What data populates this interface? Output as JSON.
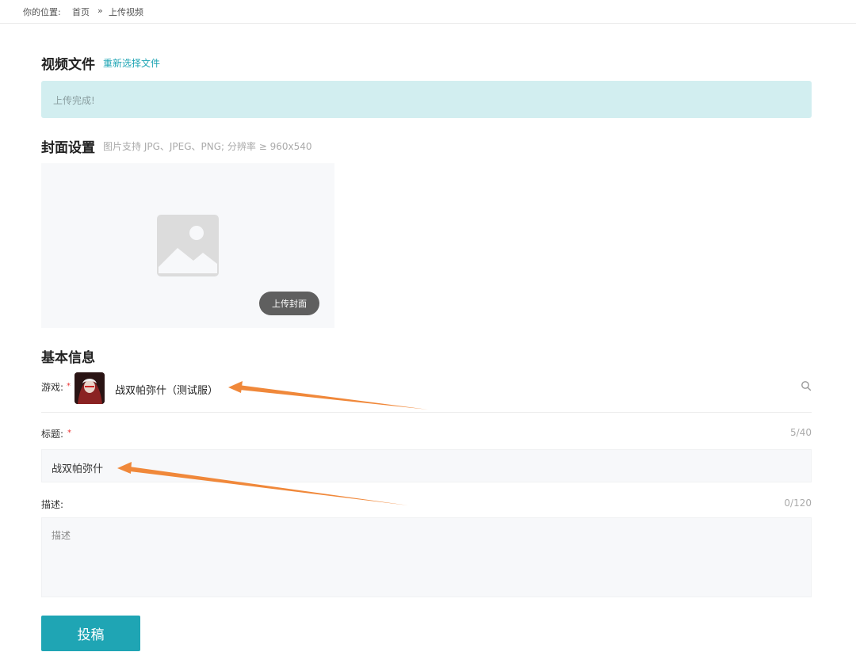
{
  "breadcrumb": {
    "prefix": "你的位置:",
    "home": "首页",
    "separator": "»",
    "current": "上传视频"
  },
  "video_file": {
    "title": "视频文件",
    "reselect_link": "重新选择文件",
    "status": "上传完成!"
  },
  "cover": {
    "title": "封面设置",
    "hint": "图片支持 JPG、JPEG、PNG; 分辨率 ≥ 960x540",
    "upload_button": "上传封面",
    "placeholder_icon": "image-placeholder-icon"
  },
  "basic_info": {
    "title": "基本信息",
    "game": {
      "label": "游戏:",
      "required_mark": "*",
      "value": "战双帕弥什（测试服）",
      "search_icon": "search-icon"
    },
    "title_field": {
      "label": "标题:",
      "required_mark": "*",
      "value": "战双帕弥什",
      "counter": "5/40"
    },
    "description": {
      "label": "描述:",
      "placeholder": "描述",
      "counter": "0/120"
    }
  },
  "submit_button": "投稿",
  "colors": {
    "accent": "#1fa5b4",
    "notice_bg": "#d2eef0",
    "annotation_arrow": "#f0883a",
    "required": "#ee3333"
  }
}
